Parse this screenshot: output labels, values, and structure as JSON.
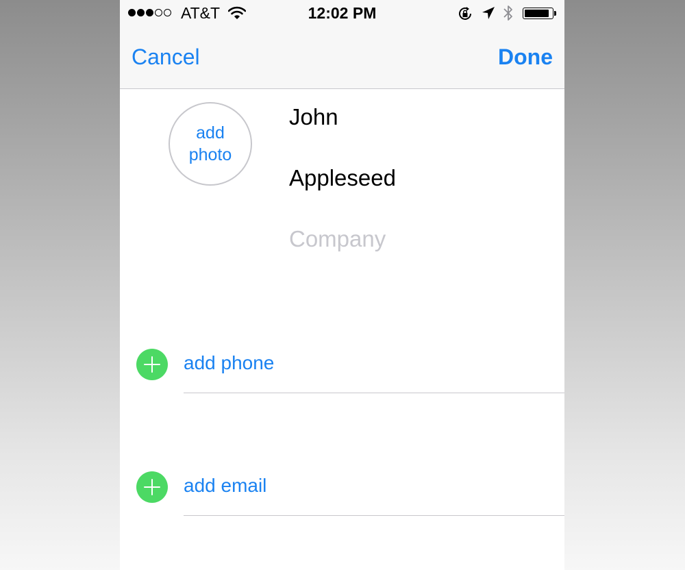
{
  "status_bar": {
    "signal_full": 3,
    "signal_total": 5,
    "carrier": "AT&T",
    "time": "12:02 PM",
    "icons": [
      "wifi-icon",
      "rotation-lock-icon",
      "location-arrow-icon",
      "bluetooth-icon",
      "battery-icon"
    ],
    "battery_level": 0.9
  },
  "nav": {
    "cancel_label": "Cancel",
    "done_label": "Done"
  },
  "contact": {
    "add_photo_line1": "add",
    "add_photo_line2": "photo",
    "first_name": "John",
    "last_name": "Appleseed",
    "company_placeholder": "Company"
  },
  "actions": {
    "add_phone_label": "add phone",
    "add_email_label": "add email"
  },
  "colors": {
    "accent": "#1a82f1",
    "add_button": "#4cd964",
    "placeholder": "#c7c7cd"
  }
}
